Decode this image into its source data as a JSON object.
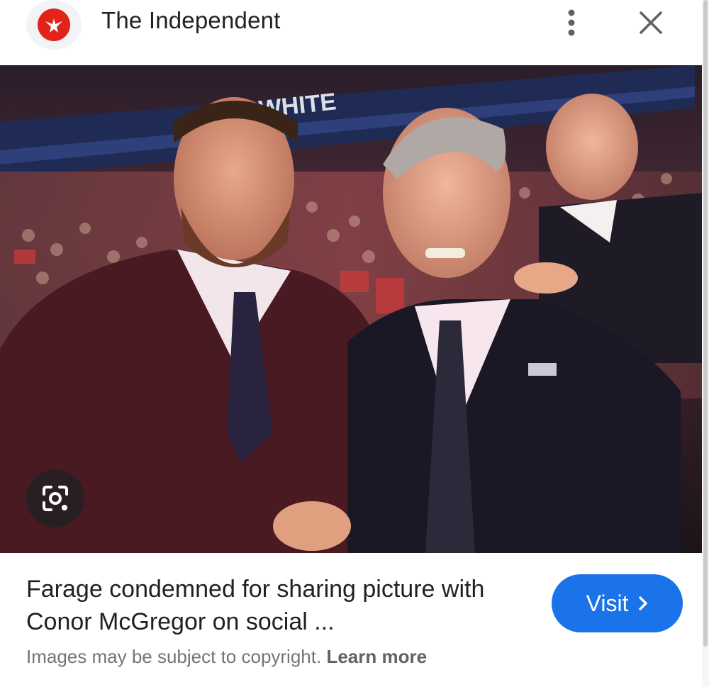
{
  "header": {
    "site_name": "The Independent",
    "logo_icon": "eagle-logo-icon",
    "more_icon": "more-vert-icon",
    "close_icon": "close-icon"
  },
  "image": {
    "description_icon": "photo",
    "banner_text": "WHITE",
    "lens_icon": "google-lens-icon"
  },
  "result": {
    "title": "Farage condemned for sharing picture with Conor McGregor on social ...",
    "visit_label": "Visit",
    "copyright_text": "Images may be subject to copyright.",
    "learn_more": "Learn more"
  },
  "colors": {
    "accent": "#1a73e8",
    "brand": "#e2231a",
    "text": "#202124",
    "muted": "#70757a"
  }
}
